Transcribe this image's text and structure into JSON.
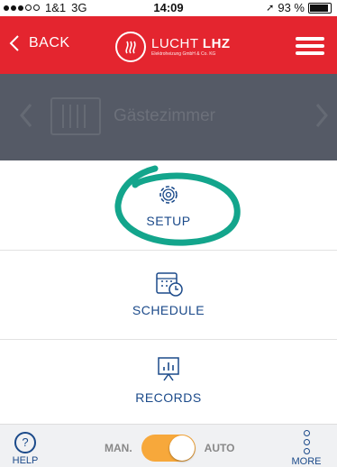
{
  "status_bar": {
    "carrier": "1&1",
    "network": "3G",
    "time": "14:09",
    "battery": "93 %"
  },
  "header": {
    "back_label": "BACK",
    "logo_name": "LUCHT",
    "logo_brand": "LHZ",
    "logo_sub": "Elektroheizung GmbH & Co. KG"
  },
  "room": {
    "name": "Gästezimmer"
  },
  "menu_items": [
    {
      "label": "SETUP",
      "icon": "gear-icon"
    },
    {
      "label": "SCHEDULE",
      "icon": "calendar-clock-icon"
    },
    {
      "label": "RECORDS",
      "icon": "chart-board-icon"
    }
  ],
  "bottom": {
    "help": "HELP",
    "mode_man": "MAN.",
    "mode_auto": "AUTO",
    "mode_auto_on": true,
    "more": "MORE"
  },
  "colors": {
    "header": "#e4252f",
    "room_bar": "#555a66",
    "label": "#1b4a8a",
    "toggle": "#f7a83b",
    "annotation": "#13a58c"
  }
}
